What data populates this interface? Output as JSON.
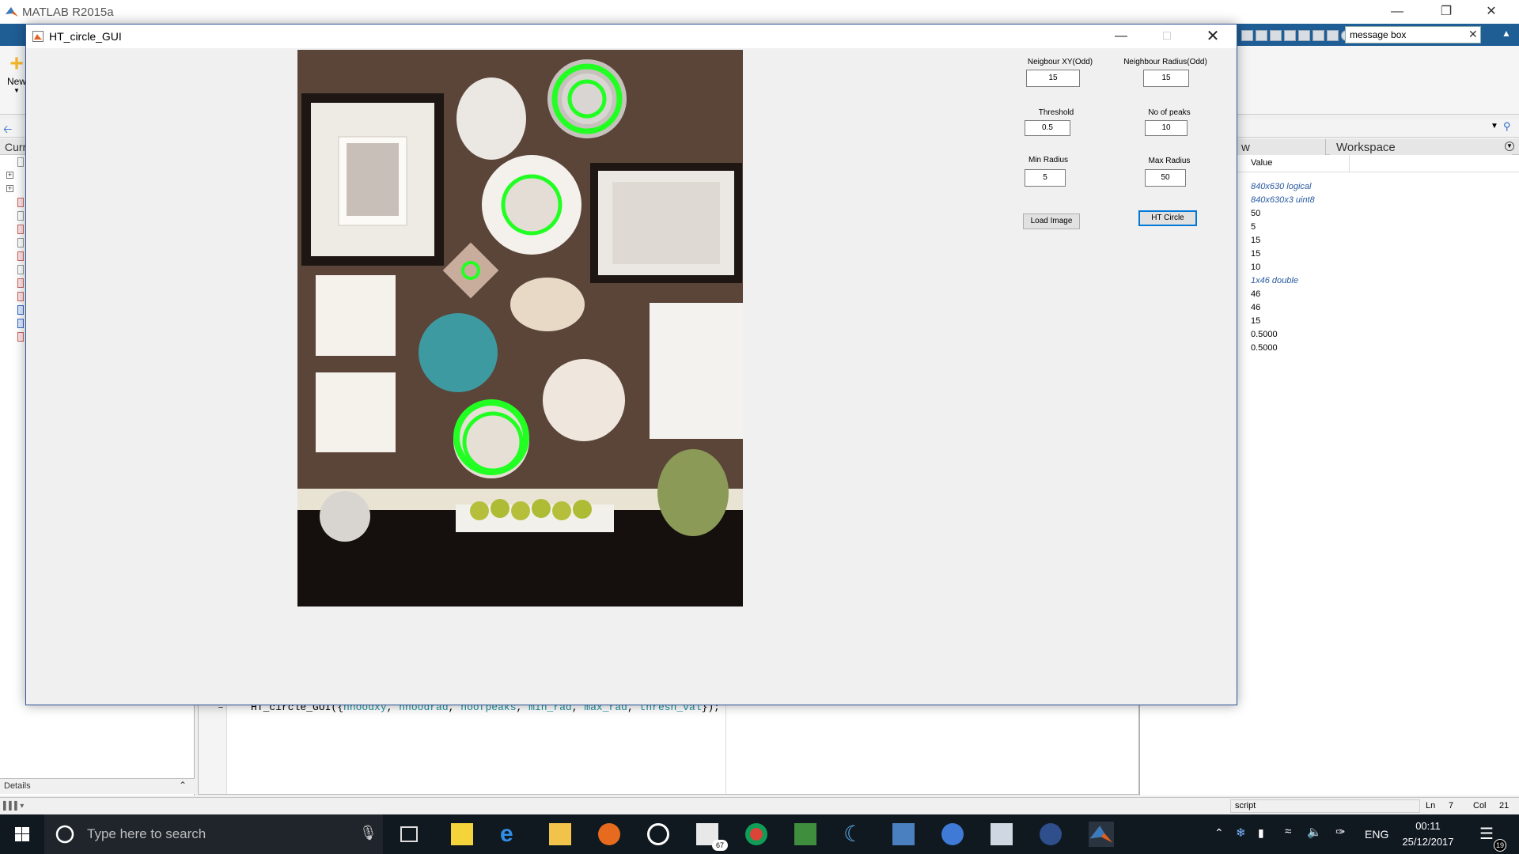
{
  "matlab": {
    "title": "MATLAB R2015a",
    "toolstrip": {
      "new_label": "New"
    },
    "help_search": {
      "value": "message box"
    },
    "left_panel": {
      "header": "Curr",
      "details_label": "Details"
    },
    "editor": {
      "code_prefix": "HT_circle_GUI({",
      "vars": [
        "nhoodxy",
        "nhoodrad",
        "noofpeaks",
        "min_rad",
        "max_rad",
        "thresh_val"
      ],
      "code_suffix": "});"
    },
    "workspace": {
      "tab_other": "w",
      "tab_label": "Workspace",
      "value_header": "Value",
      "values": [
        {
          "text": "840x630 logical",
          "italic": true
        },
        {
          "text": "840x630x3 uint8",
          "italic": true
        },
        {
          "text": "50",
          "italic": false
        },
        {
          "text": "5",
          "italic": false
        },
        {
          "text": "15",
          "italic": false
        },
        {
          "text": "15",
          "italic": false
        },
        {
          "text": "10",
          "italic": false
        },
        {
          "text": "1x46 double",
          "italic": true
        },
        {
          "text": "46",
          "italic": false
        },
        {
          "text": "46",
          "italic": false
        },
        {
          "text": "15",
          "italic": false
        },
        {
          "text": "0.5000",
          "italic": false
        },
        {
          "text": "0.5000",
          "italic": false
        }
      ]
    },
    "status_bar": {
      "script": "script",
      "ln_label": "Ln",
      "ln_value": "7",
      "col_label": "Col",
      "col_value": "21"
    }
  },
  "gui": {
    "title": "HT_circle_GUI",
    "params": {
      "neighbour_xy": {
        "label": "Neigbour XY(Odd)",
        "value": "15"
      },
      "neighbour_radius": {
        "label": "Neighbour Radius(Odd)",
        "value": "15"
      },
      "threshold": {
        "label": "Threshold",
        "value": "0.5"
      },
      "no_of_peaks": {
        "label": "No of peaks",
        "value": "10"
      },
      "min_radius": {
        "label": "Min Radius",
        "value": "5"
      },
      "max_radius": {
        "label": "Max Radius",
        "value": "50"
      }
    },
    "buttons": {
      "load_image": "Load Image",
      "ht_circle": "HT Circle"
    },
    "colors": {
      "detected_circle": "#22ff22",
      "wall": "#5b4539"
    }
  },
  "taskbar": {
    "search_placeholder": "Type here to search",
    "mail_badge": "67",
    "language": "ENG",
    "time": "00:11",
    "date": "25/12/2017",
    "notification_count": "19"
  }
}
